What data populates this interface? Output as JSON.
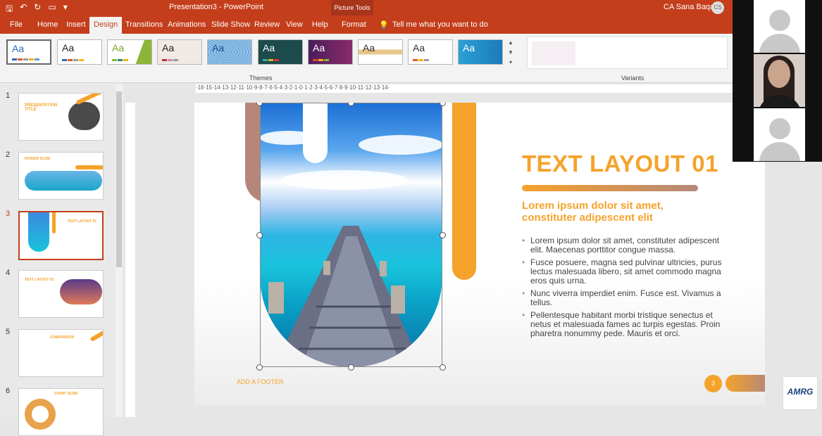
{
  "titlebar": {
    "document": "Presentation3  -  PowerPoint",
    "context_tab": "Picture Tools",
    "user": "CA Sana Baqai",
    "user_initials": "CS"
  },
  "tabs": [
    "File",
    "Home",
    "Insert",
    "Design",
    "Transitions",
    "Animations",
    "Slide Show",
    "Review",
    "View",
    "Help",
    "Format"
  ],
  "active_tab": "Design",
  "tell_me": "Tell me what you want to do",
  "ribbon": {
    "themes_label": "Themes",
    "variants_label": "Variants",
    "theme_glyph": "Aa"
  },
  "thumbnails": [
    {
      "num": "1",
      "title": "PRESENTATION TITLE"
    },
    {
      "num": "2",
      "title": "DIVIDER SLIDE"
    },
    {
      "num": "3",
      "title": "TEXT LAYOUT 01"
    },
    {
      "num": "4",
      "title": "TEXT LAYOUT 02"
    },
    {
      "num": "5",
      "title": "COMPARISON"
    },
    {
      "num": "6",
      "title": "CHART SLIDE"
    }
  ],
  "ruler_text": "·16·15·14·13·12·11·10·9·8·7·6·5·4·3·2·1·0·1·2·3·4·5·6·7·8·9·10·11·12·13·14·",
  "slide": {
    "title": "TEXT LAYOUT 01",
    "subtitle": "Lorem ipsum dolor sit amet, constituter adipescent elit",
    "bullets": [
      "Lorem ipsum dolor sit amet, constituter adipescent elit. Maecenas porttitor congue massa.",
      "Fusce posuere, magna sed pulvinar ultricies, purus lectus malesuada libero, sit amet commodo magna eros quis urna.",
      "Nunc viverra imperdiet enim. Fusce est. Vivamus a tellus.",
      "Pellentesque habitant morbi tristique senectus et netus et malesuada fames ac turpis egestas. Proin pharetra nonummy pede. Mauris et orci."
    ],
    "footer": "ADD A FOOTER",
    "page_number": "3"
  },
  "logo_text": "AMRG",
  "colors": {
    "accent": "#c43e1c",
    "orange": "#f5a22a",
    "brown": "#b5877a"
  }
}
